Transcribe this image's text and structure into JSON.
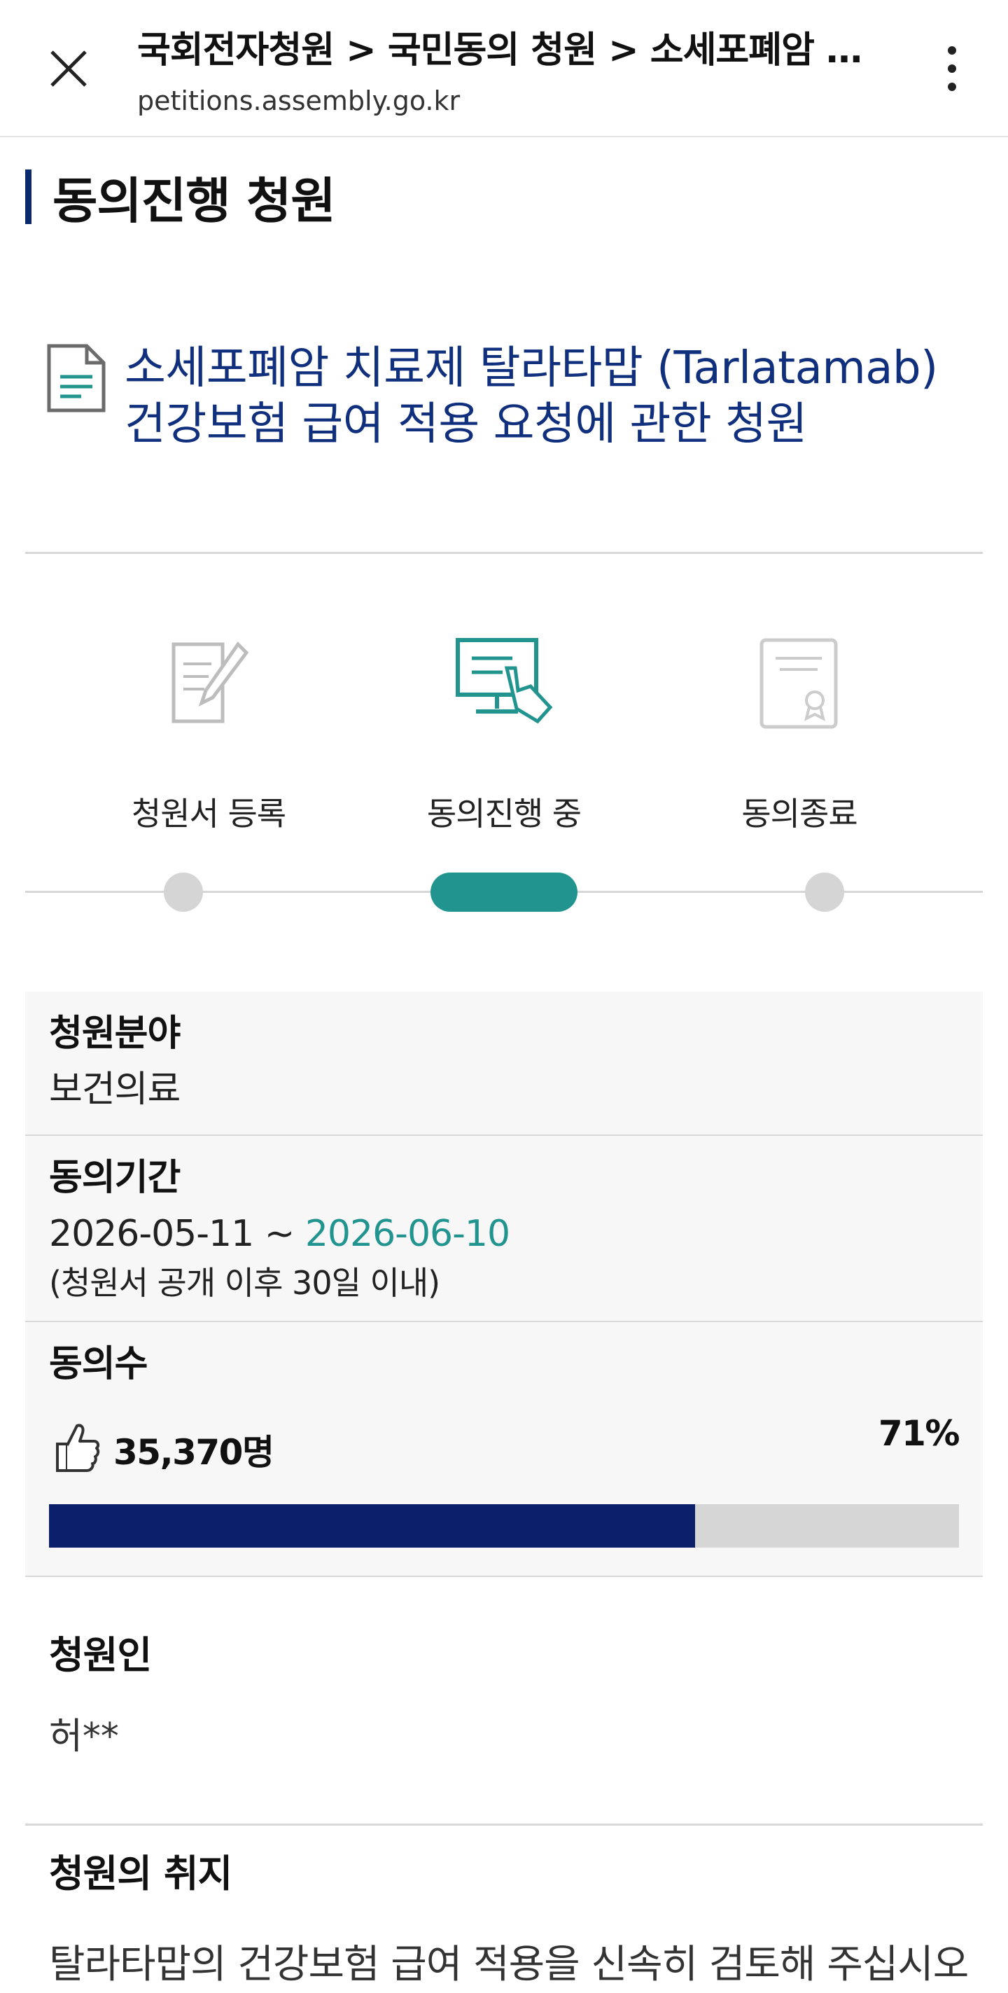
{
  "browser": {
    "title": "국회전자청원 > 국민동의 청원 > 소세포폐암 치료제 탈라타맙 건강보험 급여 적용 요청에 관한 청원",
    "url": "petitions.assembly.go.kr",
    "close_icon": "close-icon",
    "menu_icon": "more-vertical-icon"
  },
  "section": {
    "heading": "동의진행 청원"
  },
  "petition": {
    "title": "소세포폐암 치료제 탈라타맙 (Tarlatamab) 건강보험 급여 적용 요청에 관한 청원",
    "icon": "document-icon"
  },
  "steps": [
    {
      "label": "청원서 등록",
      "icon": "pen-document-icon",
      "state": "done"
    },
    {
      "label": "동의진행 중",
      "icon": "monitor-click-icon",
      "state": "active"
    },
    {
      "label": "동의종료",
      "icon": "certificate-icon",
      "state": "pending"
    }
  ],
  "info": {
    "field_label": "청원분야",
    "field_value": "보건의료",
    "period_label": "동의기간",
    "period_start": "2026-05-11",
    "period_sep": " ~ ",
    "period_end": "2026-06-10",
    "period_note": "(청원서 공개 이후 30일 이내)",
    "agree_label": "동의수",
    "agree_count": "35,370명",
    "agree_percent": "71%",
    "agree_fraction": 0.71
  },
  "petitioner": {
    "label": "청원인",
    "value": "허**"
  },
  "purpose": {
    "label": "청원의 취지",
    "text": "탈라타맙의 건강보험 급여 적용을 신속히 검토해 주십시오"
  },
  "colors": {
    "accent_teal": "#22948f",
    "navy": "#0b1f6b",
    "title_blue": "#10307e"
  }
}
